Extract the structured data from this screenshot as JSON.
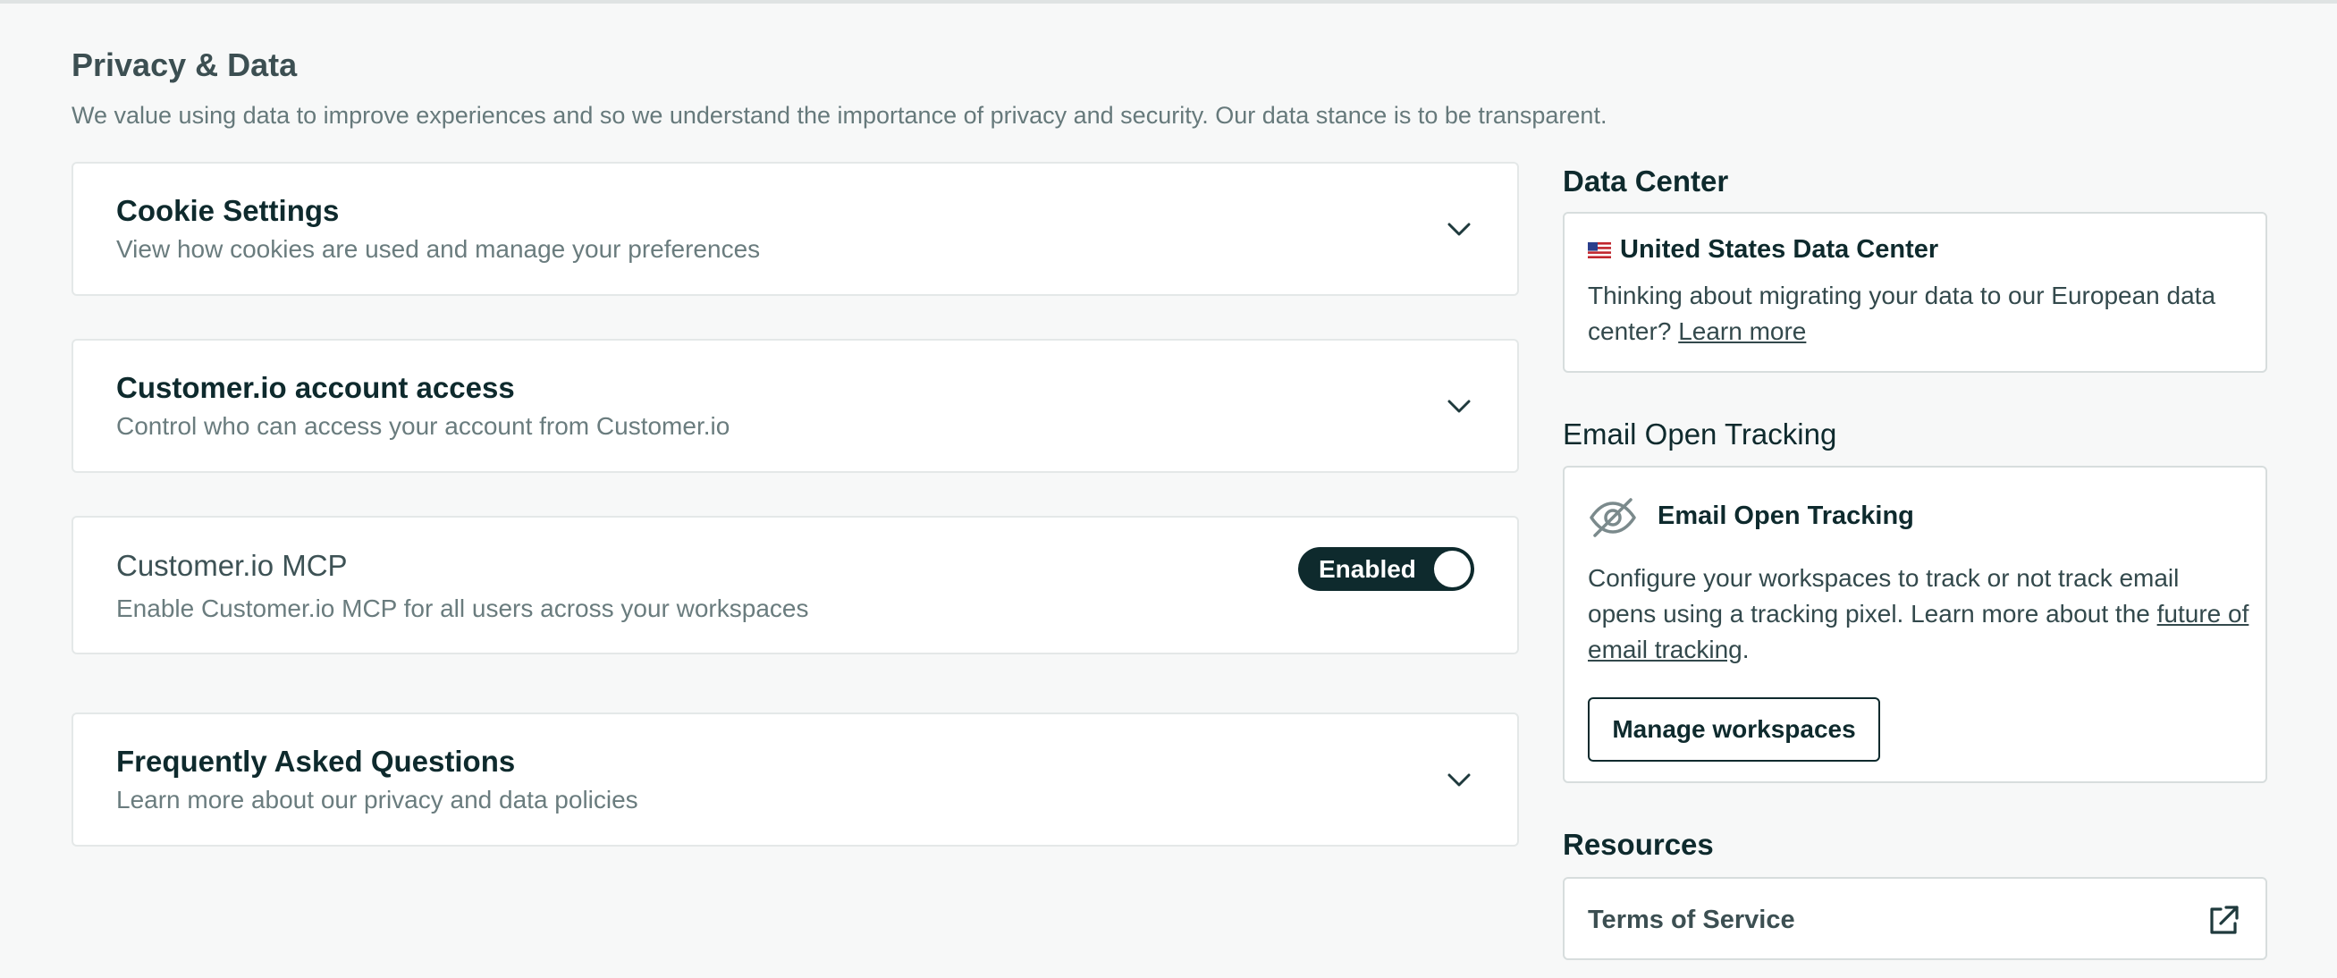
{
  "header": {
    "title": "Privacy & Data",
    "description": "We value using data to improve experiences and so we understand the importance of privacy and security. Our data stance is to be transparent."
  },
  "sections": [
    {
      "title": "Cookie Settings",
      "subtitle": "View how cookies are used and manage your preferences",
      "control": "chevron-down-icon"
    },
    {
      "title": "Customer.io account access",
      "subtitle": "Control who can access your account from Customer.io",
      "control": "chevron-down-icon"
    },
    {
      "title": "Customer.io MCP",
      "subtitle": "Enable Customer.io MCP for all users across your workspaces",
      "control": "toggle",
      "toggle_label": "Enabled",
      "toggle_on": true
    },
    {
      "title": "Frequently Asked Questions",
      "subtitle": "Learn more about our privacy and data policies",
      "control": "chevron-down-icon"
    }
  ],
  "data_center": {
    "heading": "Data Center",
    "flag_icon": "us-flag-icon",
    "title": "United States Data Center",
    "text": "Thinking about migrating your data to our European data center?",
    "link": "Learn more"
  },
  "email_open_tracking": {
    "heading": "Email Open Tracking",
    "icon": "eye-off-icon",
    "title": "Email Open Tracking",
    "text": "Configure your workspaces to track or not track email opens using a tracking pixel. Learn more about the",
    "link": "future of email tracking",
    "text_end": ".",
    "button": "Manage workspaces"
  },
  "resources": {
    "heading": "Resources",
    "items": [
      {
        "label": "Terms of Service",
        "icon": "external-link-icon"
      }
    ]
  },
  "colors": {
    "background": "#f7f8f8",
    "dark": "#0e2a2d",
    "muted_text": "#6a7c7e",
    "card_border": "#e4e8e8"
  }
}
